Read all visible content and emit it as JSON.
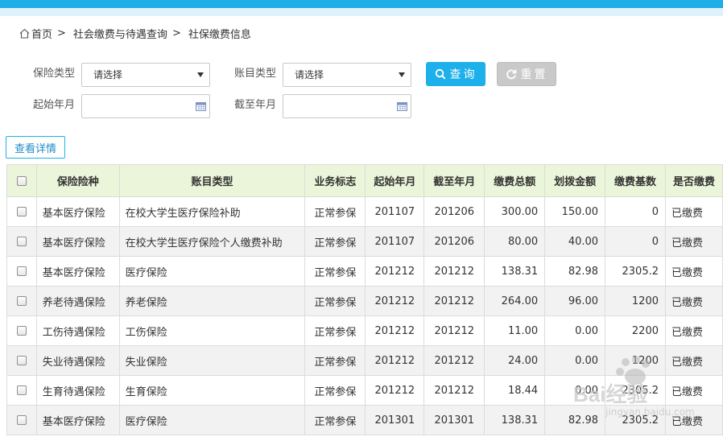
{
  "breadcrumb": {
    "home": "首页",
    "level1": "社会缴费与待遇查询",
    "level2": "社保缴费信息",
    "separator": ">"
  },
  "filters": {
    "insurance_type_label": "保险类型",
    "insurance_type_value": "请选择",
    "account_type_label": "账目类型",
    "account_type_value": "请选择",
    "start_month_label": "起始年月",
    "start_month_value": "",
    "end_month_label": "截至年月",
    "end_month_value": ""
  },
  "buttons": {
    "query": "查询",
    "reset": "重置",
    "detail": "查看详情"
  },
  "table": {
    "headers": [
      "保险险种",
      "账目类型",
      "业务标志",
      "起始年月",
      "截至年月",
      "缴费总额",
      "划拨金额",
      "缴费基数",
      "是否缴费"
    ],
    "rows": [
      [
        "基本医疗保险",
        "在校大学生医疗保险补助",
        "正常参保",
        "201107",
        "201206",
        "300.00",
        "150.00",
        "0",
        "已缴费"
      ],
      [
        "基本医疗保险",
        "在校大学生医疗保险个人缴费补助",
        "正常参保",
        "201107",
        "201206",
        "80.00",
        "40.00",
        "0",
        "已缴费"
      ],
      [
        "基本医疗保险",
        "医疗保险",
        "正常参保",
        "201212",
        "201212",
        "138.31",
        "82.98",
        "2305.2",
        "已缴费"
      ],
      [
        "养老待遇保险",
        "养老保险",
        "正常参保",
        "201212",
        "201212",
        "264.00",
        "96.00",
        "1200",
        "已缴费"
      ],
      [
        "工伤待遇保险",
        "工伤保险",
        "正常参保",
        "201212",
        "201212",
        "11.00",
        "0.00",
        "2200",
        "已缴费"
      ],
      [
        "失业待遇保险",
        "失业保险",
        "正常参保",
        "201212",
        "201212",
        "24.00",
        "0.00",
        "1200",
        "已缴费"
      ],
      [
        "生育待遇保险",
        "生育保险",
        "正常参保",
        "201212",
        "201212",
        "18.44",
        "0.00",
        "2305.2",
        "已缴费"
      ],
      [
        "基本医疗保险",
        "医疗保险",
        "正常参保",
        "201301",
        "201301",
        "138.31",
        "82.98",
        "2305.2",
        "已缴费"
      ]
    ]
  },
  "watermark": {
    "text": "Bai经验",
    "url": "jingyan.baidu.com"
  },
  "colors": {
    "accent": "#1eb0ea",
    "header_bg": "#eaf5d9",
    "reset_bg": "#c9c9c9"
  }
}
